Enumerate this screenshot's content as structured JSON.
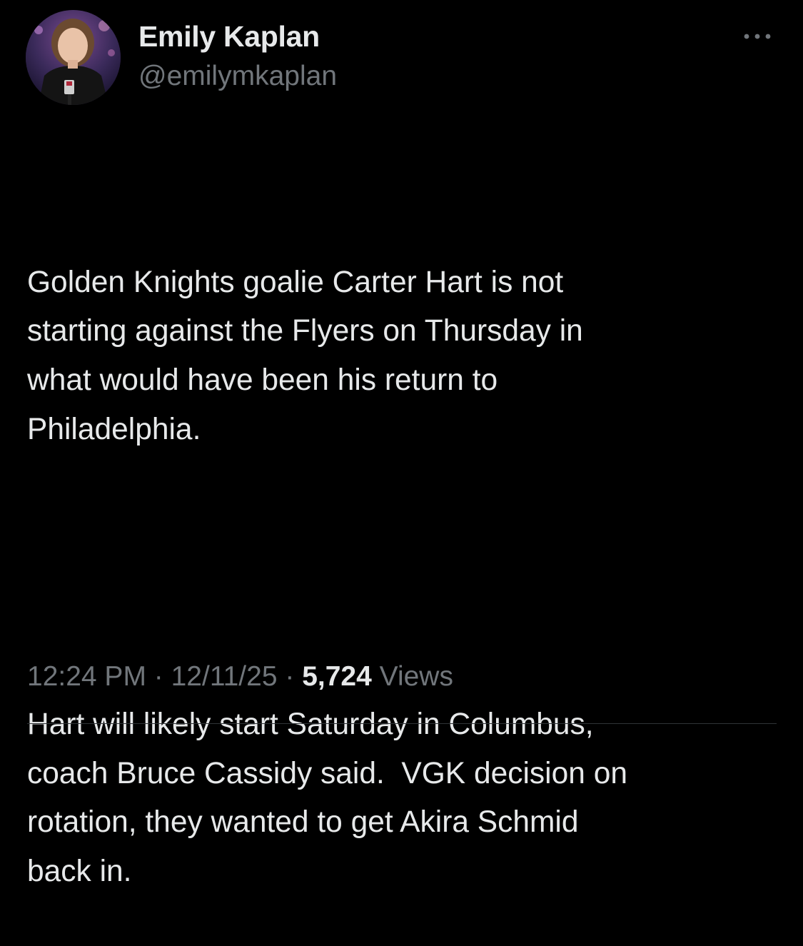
{
  "author": {
    "display_name": "Emily Kaplan",
    "handle": "@emilymkaplan"
  },
  "tweet": {
    "paragraphs": [
      "Golden Knights goalie Carter Hart is not\nstarting against the Flyers on Thursday in\nwhat would have been his return to\nPhiladelphia.",
      "Hart will likely start Saturday in Columbus,\ncoach Bruce Cassidy said.  VGK decision on\nrotation, they wanted to get Akira Schmid\nback in."
    ]
  },
  "meta": {
    "time": "12:24 PM",
    "separator": " · ",
    "date": "12/11/25",
    "views_count": "5,724",
    "views_label": " Views"
  },
  "icons": {
    "more": "more-horizontal-icon"
  },
  "colors": {
    "background": "#000000",
    "primary_text": "#e7e9ea",
    "secondary_text": "#71767b",
    "divider": "#2f3336"
  }
}
